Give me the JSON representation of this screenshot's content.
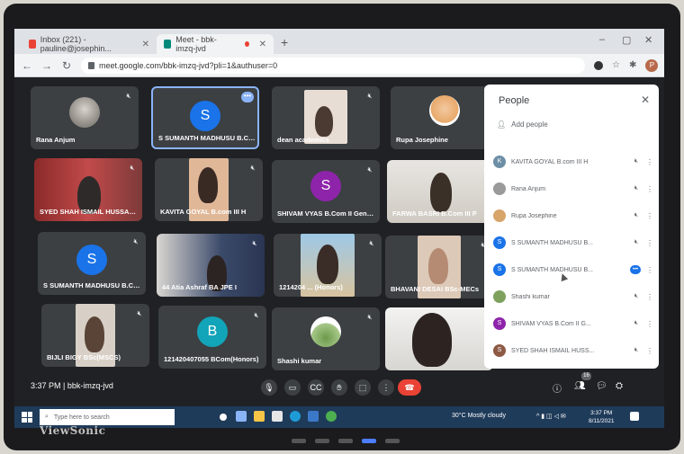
{
  "browser": {
    "tabs": [
      {
        "label": "Inbox (221) - pauline@josephin..."
      },
      {
        "label": "Meet - bbk-imzq-jvd"
      }
    ],
    "new_tab": "+",
    "url": "meet.google.com/bbk-imzq-jvd?pli=1&authuser=0",
    "profile_letter": "P"
  },
  "tiles": [
    {
      "name": "Rana Anjum"
    },
    {
      "name": "S SUMANTH MADHUSU B.Co...",
      "letter": "S"
    },
    {
      "name": "dean academics"
    },
    {
      "name": "Rupa Josephine"
    },
    {
      "name": "SYED SHAH ISMAIL HUSSAIN..."
    },
    {
      "name": "KAVITA GOYAL B.com III H"
    },
    {
      "name": "SHIVAM VYAS B.Com II General",
      "letter": "S"
    },
    {
      "name": "FARWA BASRI B.Com III P"
    },
    {
      "name": "S SUMANTH MADHUSU B.Co...",
      "letter": "S"
    },
    {
      "name": "44 Atia Ashraf BA JPE I"
    },
    {
      "name": "1214204 ... (Honors)"
    },
    {
      "name": "BHAVANI DESAI BSc-MECs"
    },
    {
      "name": "BIJLI BIGY BSc(MSCS)"
    },
    {
      "name": "121420407055 BCom(Honors)",
      "letter": "B"
    },
    {
      "name": "Shashi kumar"
    },
    {
      "name": ""
    }
  ],
  "callbar": {
    "time": "3:37 PM",
    "separator": "|",
    "meeting_code": "bbk-imzq-jvd",
    "participants_badge": "16"
  },
  "people_panel": {
    "title": "People",
    "add_people": "Add people",
    "rows": [
      {
        "name": "KAVITA GOYAL B.com III H",
        "letter": "K",
        "color": "#6d8fa6"
      },
      {
        "name": "Rana Anjum",
        "letter": "",
        "color": "#9a9a9a"
      },
      {
        "name": "Rupa Josephine",
        "letter": "",
        "color": "#d7a46a"
      },
      {
        "name": "S SUMANTH MADHUSU B...",
        "letter": "S",
        "color": "#1a73e8"
      },
      {
        "name": "S SUMANTH MADHUSU B...",
        "letter": "S",
        "color": "#1a73e8"
      },
      {
        "name": "Shashi kumar",
        "letter": "",
        "color": "#7fa15e"
      },
      {
        "name": "SHIVAM VYAS B.Com II G...",
        "letter": "S",
        "color": "#8e24aa"
      },
      {
        "name": "SYED SHAH ISMAIL HUSS...",
        "letter": "S",
        "color": "#8d5a45"
      }
    ]
  },
  "taskbar": {
    "search_placeholder": "Type here to search",
    "weather": "30°C  Mostly cloudy",
    "time": "3:37 PM",
    "date": "8/11/2021"
  },
  "monitor": {
    "brand": "ViewSonic"
  },
  "colors": {
    "meet_bg": "#202124",
    "tile_bg": "#3c4043",
    "accent_blue": "#8ab4f8",
    "end_call_red": "#ea4335"
  }
}
